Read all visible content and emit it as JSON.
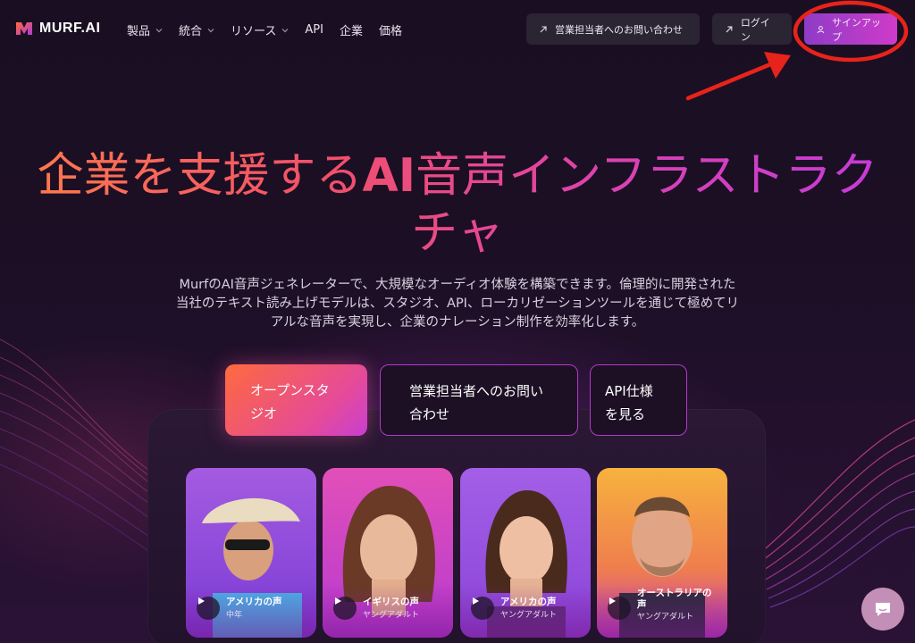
{
  "brand": {
    "name": "MURF.AI"
  },
  "nav": {
    "items": [
      {
        "label": "製品",
        "has_dropdown": true
      },
      {
        "label": "統合",
        "has_dropdown": true
      },
      {
        "label": "リソース",
        "has_dropdown": true
      },
      {
        "label": "API",
        "has_dropdown": false
      },
      {
        "label": "企業",
        "has_dropdown": false
      },
      {
        "label": "価格",
        "has_dropdown": false
      }
    ],
    "contact_sales": "営業担当者へのお問い合わせ",
    "login": "ログイン",
    "signup": "サインアップ"
  },
  "hero": {
    "title_line1_prefix": "企業を支援する",
    "title_line1_emph": "AI",
    "title_line1_suffix": "音声インフラストラク",
    "title_line2": "チャ",
    "subtitle": "MurfのAI音声ジェネレーターで、大規模なオーディオ体験を構築できます。倫理的に開発された当社のテキスト読み上げモデルは、スタジオ、API、ローカリゼーションツールを通じて極めてリアルな音声を実現し、企業のナレーション制作を効率化します。"
  },
  "cta": {
    "open_studio": "オープンスタジオ",
    "contact_sales": "営業担当者へのお問い合わせ",
    "api_docs": "API仕様を見る"
  },
  "voices": [
    {
      "name": "アメリカの声",
      "age": "中年"
    },
    {
      "name": "イギリスの声",
      "age": "ヤングアダルト"
    },
    {
      "name": "アメリカの声",
      "age": "ヤングアダルト"
    },
    {
      "name": "オーストラリアの声",
      "age": "ヤングアダルト"
    }
  ],
  "icons": {
    "external": "arrow-up-right-icon",
    "user": "user-icon",
    "play": "play-icon",
    "chat": "chat-bubble-icon"
  },
  "colors": {
    "background": "#150d1c",
    "accent_gradient_start": "#ff6a3d",
    "accent_gradient_end": "#c83fd2",
    "annotation_red": "#e8231b"
  }
}
